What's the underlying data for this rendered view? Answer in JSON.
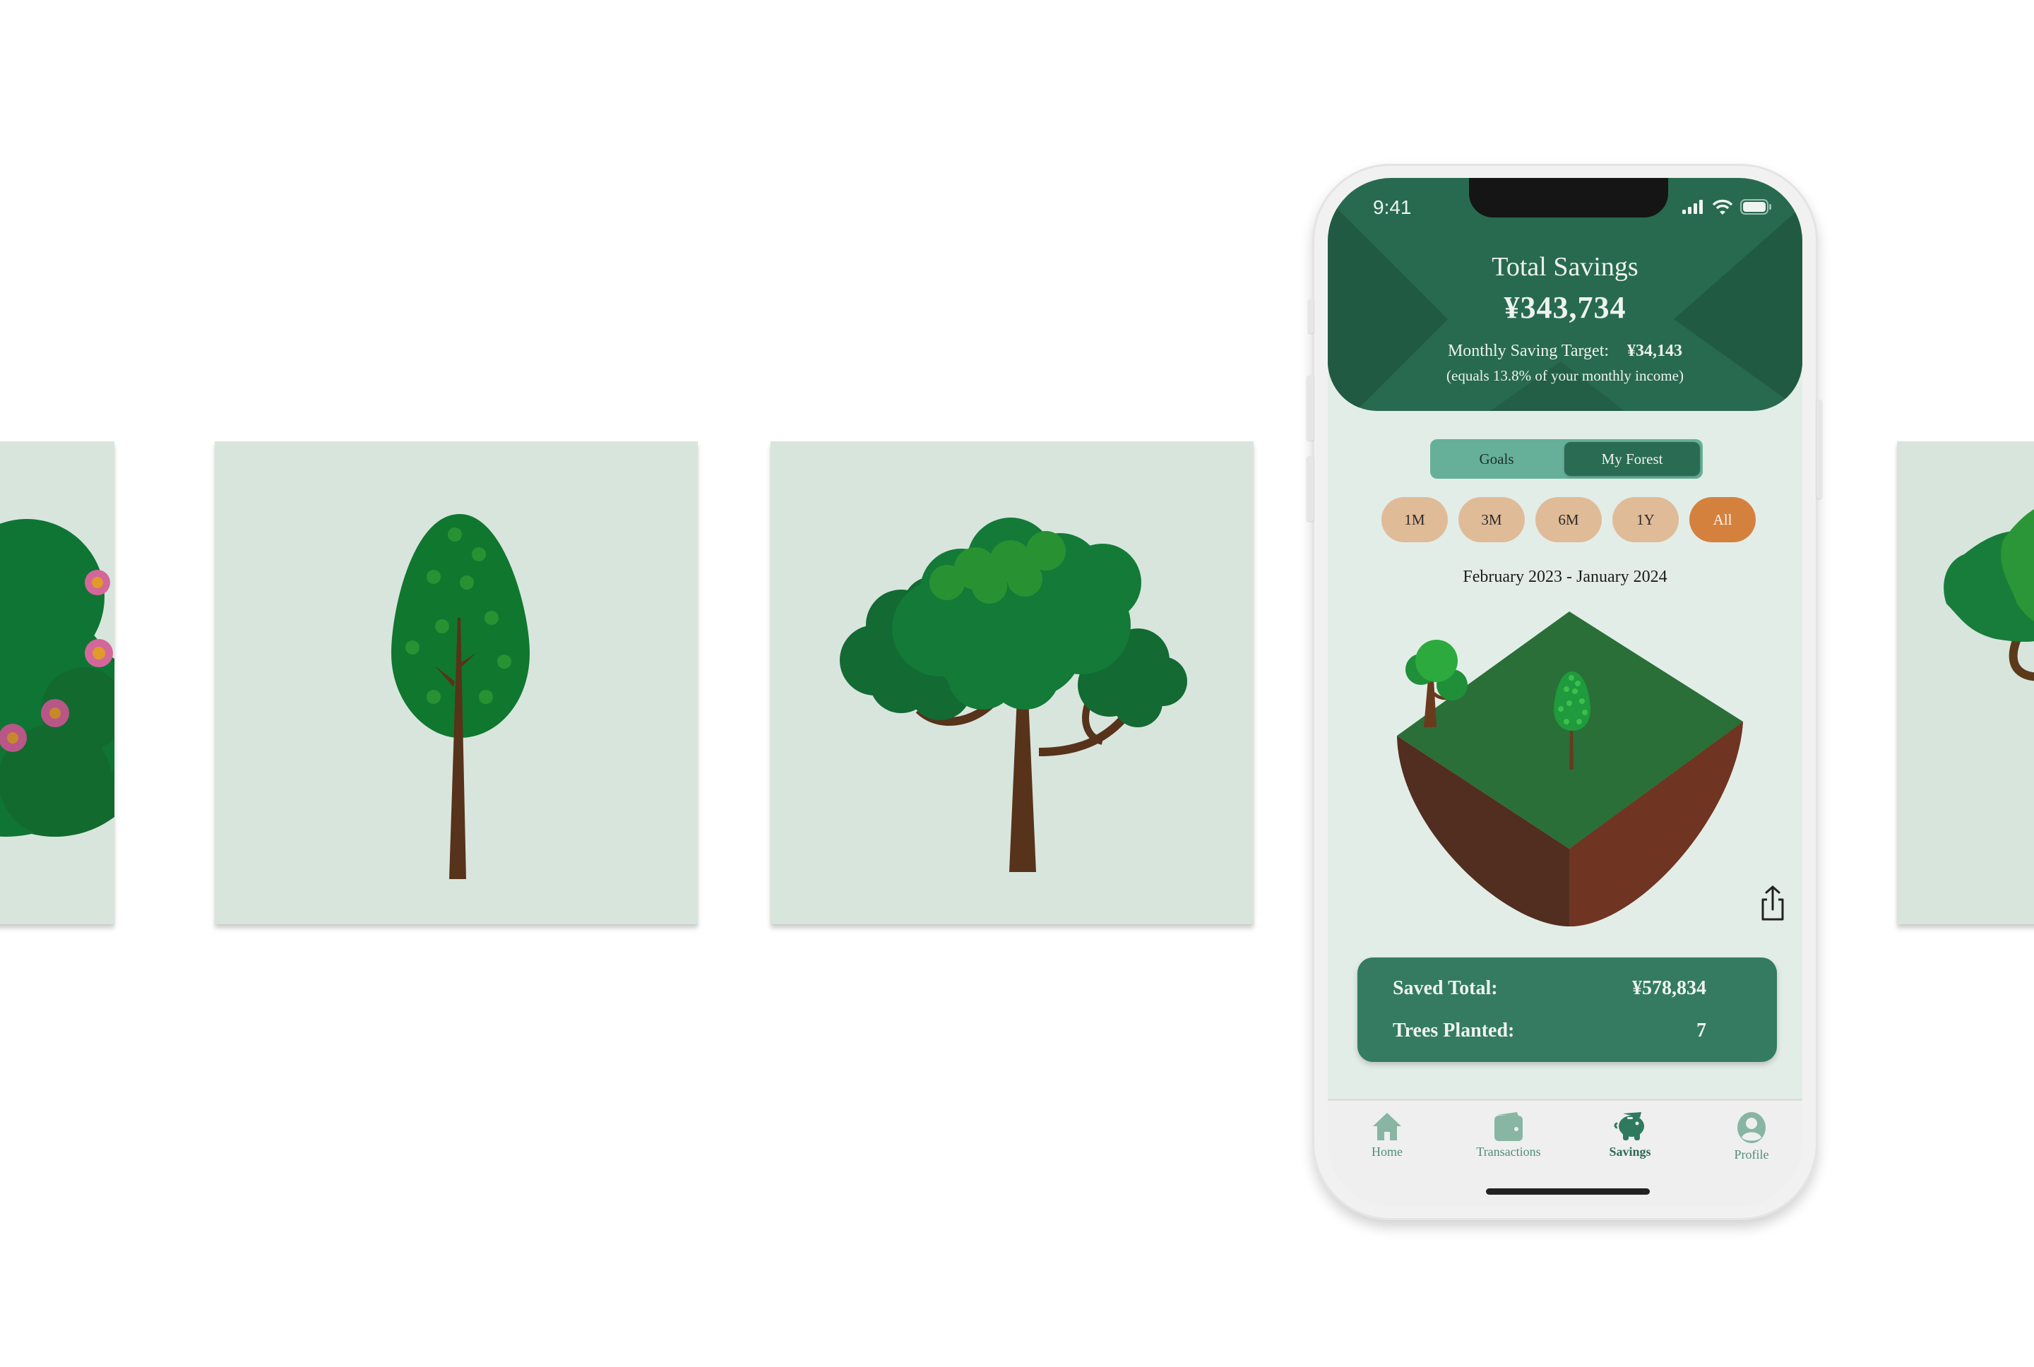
{
  "gallery": {
    "cards": [
      {
        "name": "flowering-bush",
        "visible": "partial-left"
      },
      {
        "name": "slender-tree"
      },
      {
        "name": "broad-canopy-tree"
      },
      {
        "name": "leafy-tree",
        "visible": "partial-right"
      }
    ]
  },
  "status_bar": {
    "time": "9:41",
    "icons": [
      "cellular-signal-icon",
      "wifi-icon",
      "battery-icon"
    ]
  },
  "header": {
    "title": "Total Savings",
    "amount": "¥343,734",
    "target_label": "Monthly Saving Target:",
    "target_amount": "¥34,143",
    "target_note": "(equals 13.8% of your monthly income)"
  },
  "segmented": {
    "options": [
      "Goals",
      "My Forest"
    ],
    "selected": "My Forest"
  },
  "ranges": {
    "options": [
      "1M",
      "3M",
      "6M",
      "1Y",
      "All"
    ],
    "selected": "All"
  },
  "date_range": "February 2023 - January 2024",
  "forest": {
    "trees_on_island": [
      "broad-canopy-tree",
      "slender-tree"
    ],
    "share_icon": "share-icon"
  },
  "stats": {
    "saved_total_label": "Saved Total:",
    "saved_total_value": "¥578,834",
    "trees_planted_label": "Trees Planted:",
    "trees_planted_value": "7"
  },
  "tabbar": {
    "items": [
      {
        "label": "Home",
        "icon": "home-icon"
      },
      {
        "label": "Transactions",
        "icon": "wallet-icon"
      },
      {
        "label": "Savings",
        "icon": "piggy-bank-icon"
      },
      {
        "label": "Profile",
        "icon": "profile-icon"
      }
    ],
    "selected": "Savings"
  },
  "colors": {
    "primary_green": "#276a50",
    "screen_bg": "#e3ede7",
    "card_bg": "#d8e5dd",
    "pill": "#e0bb97",
    "pill_active": "#d5813e",
    "segment_bg": "#66b09a",
    "stats_bg": "#347b61",
    "tab_icon": "#88b5a4"
  }
}
